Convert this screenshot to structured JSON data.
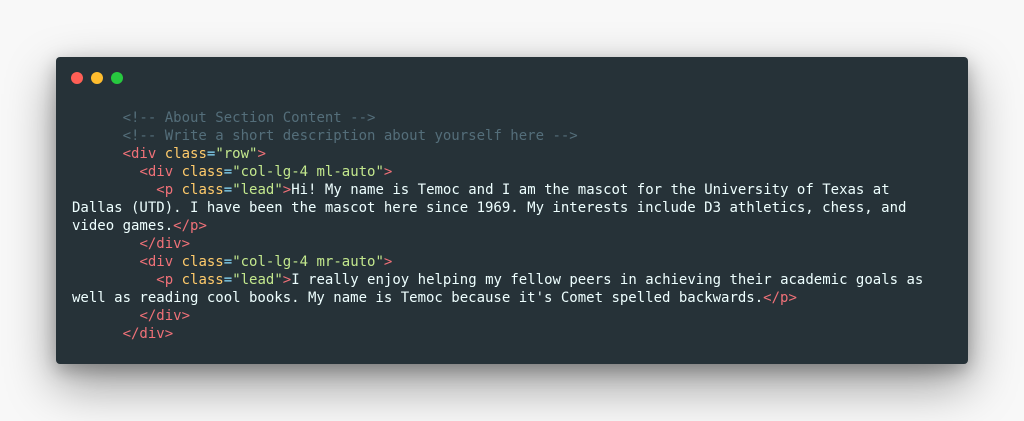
{
  "window": {
    "controls": [
      {
        "name": "close",
        "color": "#ff5f56"
      },
      {
        "name": "minimize",
        "color": "#ffbd2e"
      },
      {
        "name": "maximize",
        "color": "#27c93f"
      }
    ]
  },
  "code_lines": [
    [
      {
        "t": "comment",
        "v": "      <!-- About Section Content -->"
      }
    ],
    [
      {
        "t": "comment",
        "v": "      <!-- Write a short description about yourself here -->"
      }
    ],
    [
      {
        "t": "text",
        "v": "      "
      },
      {
        "t": "tag",
        "v": "<div"
      },
      {
        "t": "text",
        "v": " "
      },
      {
        "t": "attr",
        "v": "class"
      },
      {
        "t": "punct",
        "v": "="
      },
      {
        "t": "string",
        "v": "\"row\""
      },
      {
        "t": "tag",
        "v": ">"
      }
    ],
    [
      {
        "t": "text",
        "v": "        "
      },
      {
        "t": "tag",
        "v": "<div"
      },
      {
        "t": "text",
        "v": " "
      },
      {
        "t": "attr",
        "v": "class"
      },
      {
        "t": "punct",
        "v": "="
      },
      {
        "t": "string",
        "v": "\"col-lg-4 ml-auto\""
      },
      {
        "t": "tag",
        "v": ">"
      }
    ],
    [
      {
        "t": "text",
        "v": "          "
      },
      {
        "t": "tag",
        "v": "<p"
      },
      {
        "t": "text",
        "v": " "
      },
      {
        "t": "attr",
        "v": "class"
      },
      {
        "t": "punct",
        "v": "="
      },
      {
        "t": "string",
        "v": "\"lead\""
      },
      {
        "t": "tag",
        "v": ">"
      },
      {
        "t": "text",
        "v": "Hi! My name is Temoc and I am the mascot for the University of Texas at"
      }
    ],
    [
      {
        "t": "text",
        "v": "Dallas (UTD). I have been the mascot here since 1969. My interests include D3 athletics, chess, and"
      }
    ],
    [
      {
        "t": "text",
        "v": "video games."
      },
      {
        "t": "tag",
        "v": "</p>"
      }
    ],
    [
      {
        "t": "text",
        "v": "        "
      },
      {
        "t": "tag",
        "v": "</div>"
      }
    ],
    [
      {
        "t": "text",
        "v": "        "
      },
      {
        "t": "tag",
        "v": "<div"
      },
      {
        "t": "text",
        "v": " "
      },
      {
        "t": "attr",
        "v": "class"
      },
      {
        "t": "punct",
        "v": "="
      },
      {
        "t": "string",
        "v": "\"col-lg-4 mr-auto\""
      },
      {
        "t": "tag",
        "v": ">"
      }
    ],
    [
      {
        "t": "text",
        "v": "          "
      },
      {
        "t": "tag",
        "v": "<p"
      },
      {
        "t": "text",
        "v": " "
      },
      {
        "t": "attr",
        "v": "class"
      },
      {
        "t": "punct",
        "v": "="
      },
      {
        "t": "string",
        "v": "\"lead\""
      },
      {
        "t": "tag",
        "v": ">"
      },
      {
        "t": "text",
        "v": "I really enjoy helping my fellow peers in achieving their academic goals as"
      }
    ],
    [
      {
        "t": "text",
        "v": "well as reading cool books. My name is Temoc because it's Comet spelled backwards."
      },
      {
        "t": "tag",
        "v": "</p>"
      }
    ],
    [
      {
        "t": "text",
        "v": "        "
      },
      {
        "t": "tag",
        "v": "</div>"
      }
    ],
    [
      {
        "t": "text",
        "v": "      "
      },
      {
        "t": "tag",
        "v": "</div>"
      }
    ]
  ]
}
